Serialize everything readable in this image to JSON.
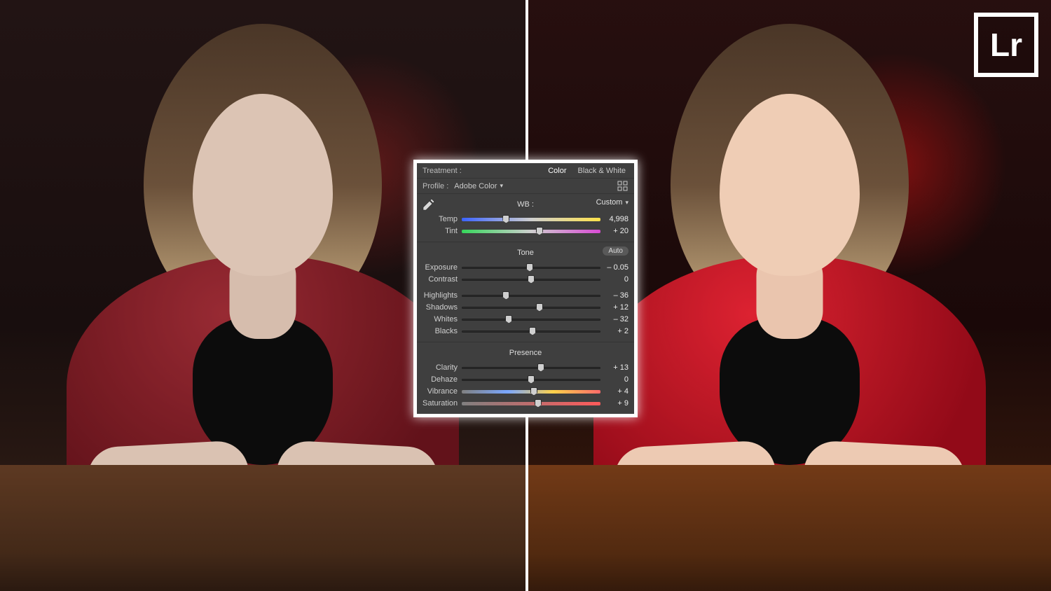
{
  "logo": "Lr",
  "treatment": {
    "label": "Treatment :",
    "color": "Color",
    "bw": "Black & White"
  },
  "profile": {
    "label": "Profile :",
    "value": "Adobe Color"
  },
  "wb": {
    "section": "WB :",
    "mode": "Custom",
    "temp": {
      "label": "Temp",
      "value": "4,998",
      "pos": 32
    },
    "tint": {
      "label": "Tint",
      "value": "+ 20",
      "pos": 56
    }
  },
  "tone": {
    "section": "Tone",
    "auto": "Auto",
    "exposure": {
      "label": "Exposure",
      "value": "– 0.05",
      "pos": 49
    },
    "contrast": {
      "label": "Contrast",
      "value": "0",
      "pos": 50
    },
    "highlights": {
      "label": "Highlights",
      "value": "– 36",
      "pos": 32
    },
    "shadows": {
      "label": "Shadows",
      "value": "+ 12",
      "pos": 56
    },
    "whites": {
      "label": "Whites",
      "value": "– 32",
      "pos": 34
    },
    "blacks": {
      "label": "Blacks",
      "value": "+ 2",
      "pos": 51
    }
  },
  "presence": {
    "section": "Presence",
    "clarity": {
      "label": "Clarity",
      "value": "+ 13",
      "pos": 57
    },
    "dehaze": {
      "label": "Dehaze",
      "value": "0",
      "pos": 50
    },
    "vibrance": {
      "label": "Vibrance",
      "value": "+ 4",
      "pos": 52
    },
    "saturation": {
      "label": "Saturation",
      "value": "+ 9",
      "pos": 55
    }
  }
}
